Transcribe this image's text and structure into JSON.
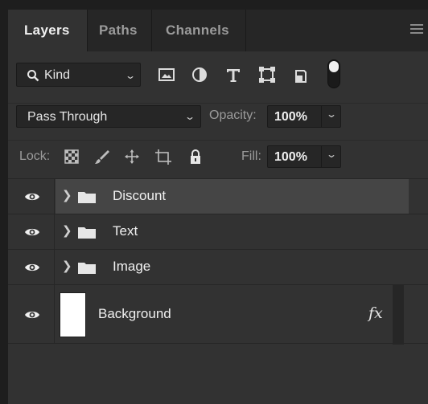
{
  "tabs": [
    {
      "label": "Layers",
      "active": true
    },
    {
      "label": "Paths",
      "active": false
    },
    {
      "label": "Channels",
      "active": false
    }
  ],
  "filter": {
    "kind_label": "Kind",
    "icons": [
      "image-filter-icon",
      "adjustment-filter-icon",
      "type-filter-icon",
      "shape-filter-icon",
      "smart-object-filter-icon",
      "filter-toggle"
    ]
  },
  "blend": {
    "mode": "Pass Through",
    "opacity_label": "Opacity:",
    "opacity_value": "100%"
  },
  "lock": {
    "label": "Lock:",
    "icons": [
      "lock-transparent-pixels-icon",
      "lock-image-pixels-icon",
      "lock-position-icon",
      "lock-artboard-icon",
      "lock-all-icon"
    ],
    "fill_label": "Fill:",
    "fill_value": "100%"
  },
  "layers": [
    {
      "name": "Discount",
      "type": "group",
      "visible": true,
      "selected": true
    },
    {
      "name": "Text",
      "type": "group",
      "visible": true,
      "selected": false
    },
    {
      "name": "Image",
      "type": "group",
      "visible": true,
      "selected": false
    },
    {
      "name": "Background",
      "type": "pixel",
      "visible": true,
      "selected": false,
      "has_fx": true,
      "fx_label": "fx"
    }
  ],
  "colors": {
    "panel_bg": "#323232",
    "tabbar_bg": "#262626",
    "selected_row": "#454545",
    "field_bg": "#262626"
  }
}
